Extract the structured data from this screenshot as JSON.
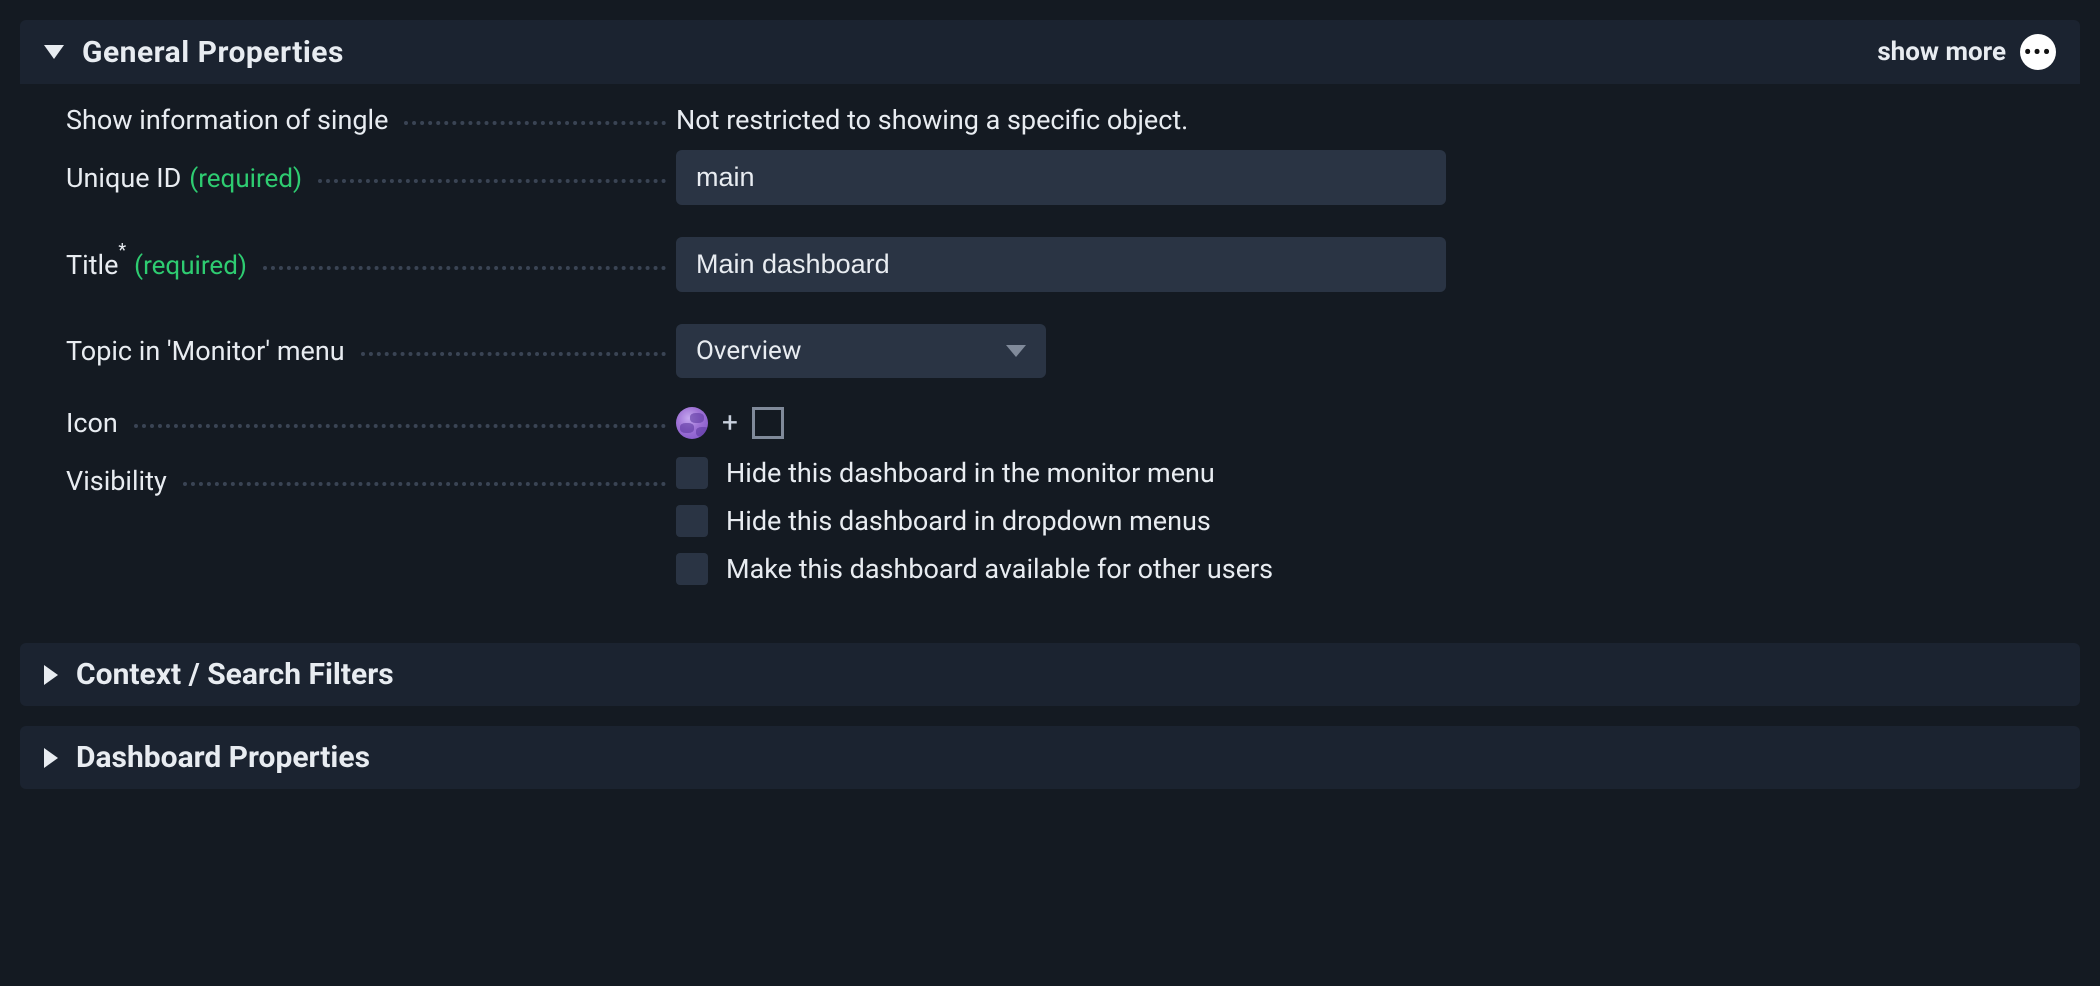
{
  "sections": {
    "general": {
      "title": "General Properties",
      "showMoreLabel": "show more",
      "fields": {
        "showInfo": {
          "label": "Show information of single",
          "value": "Not restricted to showing a specific object."
        },
        "uniqueId": {
          "label": "Unique ID",
          "required": "(required)",
          "value": "main"
        },
        "title": {
          "label": "Title",
          "asterisk": "*",
          "required": "(required)",
          "value": "Main dashboard"
        },
        "topic": {
          "label": "Topic in 'Monitor' menu",
          "value": "Overview"
        },
        "icon": {
          "label": "Icon",
          "name": "globe-icon",
          "plus": "+"
        },
        "visibility": {
          "label": "Visibility",
          "options": [
            "Hide this dashboard in the monitor menu",
            "Hide this dashboard in dropdown menus",
            "Make this dashboard available for other users"
          ]
        }
      }
    },
    "context": {
      "title": "Context / Search Filters"
    },
    "dashboard": {
      "title": "Dashboard Properties"
    }
  }
}
